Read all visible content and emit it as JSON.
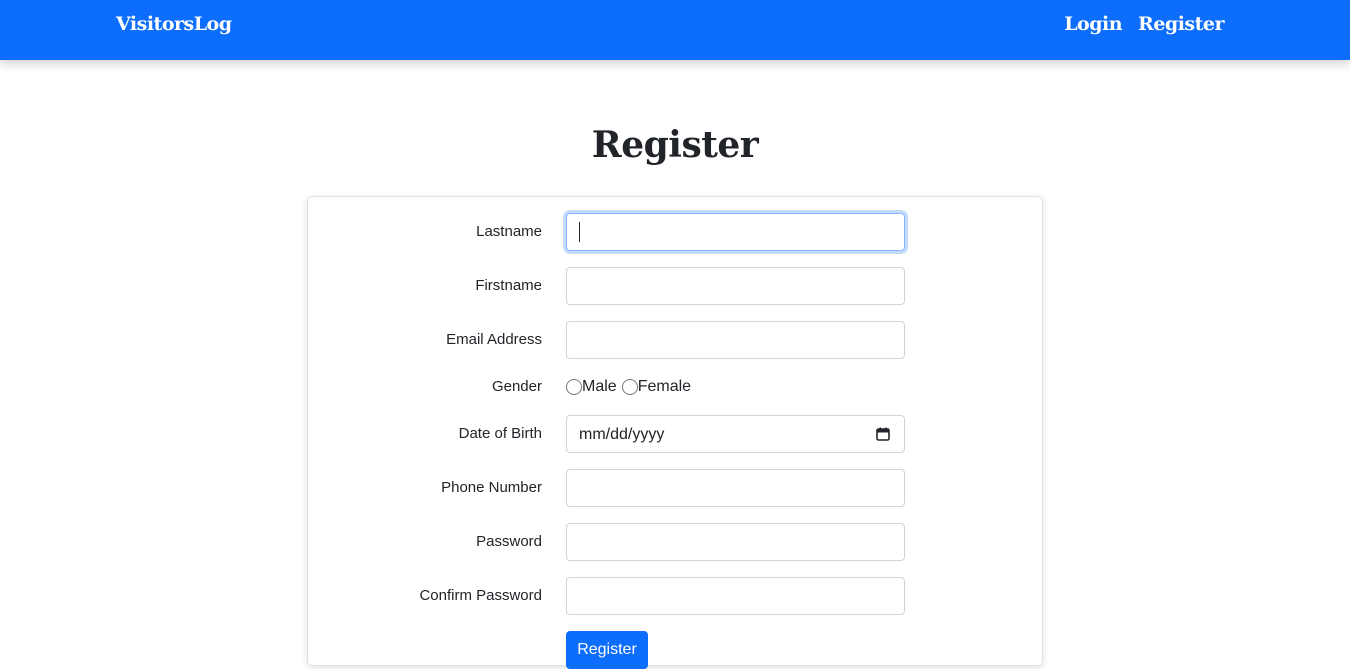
{
  "navbar": {
    "brand": "VisitorsLog",
    "links": [
      "Login",
      "Register"
    ],
    "bg_color": "#0d6efd"
  },
  "page_title": "Register",
  "form": {
    "fields": {
      "lastname": {
        "label": "Lastname",
        "value": ""
      },
      "firstname": {
        "label": "Firstname",
        "value": ""
      },
      "email": {
        "label": "Email Address",
        "value": ""
      },
      "gender": {
        "label": "Gender",
        "options": [
          "Male",
          "Female"
        ]
      },
      "dob": {
        "label": "Date of Birth",
        "placeholder": "mm/dd/yyyy",
        "icon": "calendar-icon"
      },
      "phone": {
        "label": "Phone Number",
        "value": ""
      },
      "password": {
        "label": "Password",
        "value": ""
      },
      "confirm_password": {
        "label": "Confirm Password",
        "value": ""
      }
    },
    "submit_label": "Register"
  }
}
